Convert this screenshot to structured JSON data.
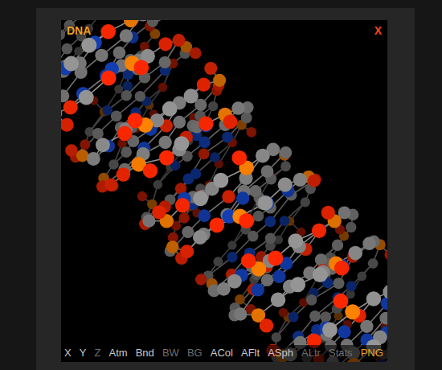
{
  "viewer": {
    "title": "DNA",
    "close": "X"
  },
  "toolbar": [
    {
      "label": "X",
      "enabled": true,
      "kind": "toggle"
    },
    {
      "label": "Y",
      "enabled": true,
      "kind": "toggle"
    },
    {
      "label": "Z",
      "enabled": false,
      "kind": "toggle"
    },
    {
      "label": "Atm",
      "enabled": true,
      "kind": "toggle"
    },
    {
      "label": "Bnd",
      "enabled": true,
      "kind": "toggle"
    },
    {
      "label": "BW",
      "enabled": false,
      "kind": "toggle"
    },
    {
      "label": "BG",
      "enabled": false,
      "kind": "toggle"
    },
    {
      "label": "ACol",
      "enabled": true,
      "kind": "toggle"
    },
    {
      "label": "AFlt",
      "enabled": true,
      "kind": "toggle"
    },
    {
      "label": "ASph",
      "enabled": true,
      "kind": "toggle"
    },
    {
      "label": "ALtr",
      "enabled": false,
      "kind": "toggle"
    },
    {
      "label": "Stats",
      "enabled": false,
      "kind": "toggle"
    },
    {
      "label": "PNG",
      "enabled": true,
      "kind": "export"
    }
  ]
}
